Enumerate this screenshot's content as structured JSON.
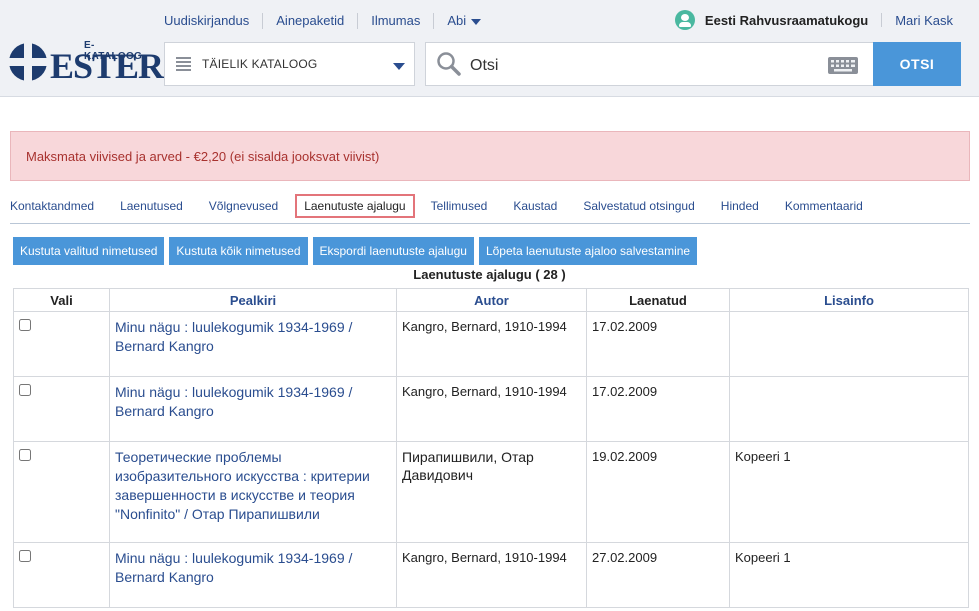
{
  "topnav": {
    "items": [
      "Uudiskirjandus",
      "Ainepaketid",
      "Ilmumas",
      "Abi"
    ]
  },
  "user": {
    "library": "Eesti Rahvusraamatukogu",
    "name": "Mari Kask"
  },
  "logo": {
    "subtitle": "E-KATALOOG",
    "word": "ESTER"
  },
  "search": {
    "catalog": "TÄIELIK KATALOOG",
    "placeholder": "Otsi",
    "button": "OTSI"
  },
  "alert": {
    "text": "Maksmata viivised ja arved - €2,20 (ei sisalda jooksvat viivist)"
  },
  "tabs": [
    "Kontaktandmed",
    "Laenutused",
    "Võlgnevused",
    "Laenutuste ajalugu",
    "Tellimused",
    "Kaustad",
    "Salvestatud otsingud",
    "Hinded",
    "Kommentaarid"
  ],
  "actions": [
    "Kustuta valitud nimetused",
    "Kustuta kõik nimetused",
    "Ekspordi laenutuste ajalugu",
    "Lõpeta laenutuste ajaloo salvestamine"
  ],
  "table": {
    "title": "Laenutuste ajalugu ( 28 )",
    "columns": [
      "Vali",
      "Pealkiri",
      "Autor",
      "Laenatud",
      "Lisainfo"
    ],
    "rows": [
      {
        "title": "Minu nägu : luulekogumik 1934-1969 / Bernard Kangro",
        "author": "Kangro, Bernard, 1910-1994",
        "date": "17.02.2009",
        "info": ""
      },
      {
        "title": "Minu nägu : luulekogumik 1934-1969 / Bernard Kangro",
        "author": "Kangro, Bernard, 1910-1994",
        "date": "17.02.2009",
        "info": ""
      },
      {
        "title": "Теоретические проблемы изобразительного искусства : критерии завершенности в искусстве и теория \"Nonfinito\" / Отар Пирапишвили",
        "author": "Пирапишвили, Отар Давидович",
        "date": "19.02.2009",
        "info": "Kopeeri 1"
      },
      {
        "title": "Minu nägu : luulekogumik 1934-1969 / Bernard Kangro",
        "author": "Kangro, Bernard, 1910-1994",
        "date": "27.02.2009",
        "info": "Kopeeri 1"
      }
    ]
  },
  "colors": {
    "accent": "#4a96d9",
    "link": "#2a4d8f",
    "alert_bg": "#f8d7da",
    "alert_text": "#a8322f",
    "active_tab_border": "#e3747a"
  }
}
